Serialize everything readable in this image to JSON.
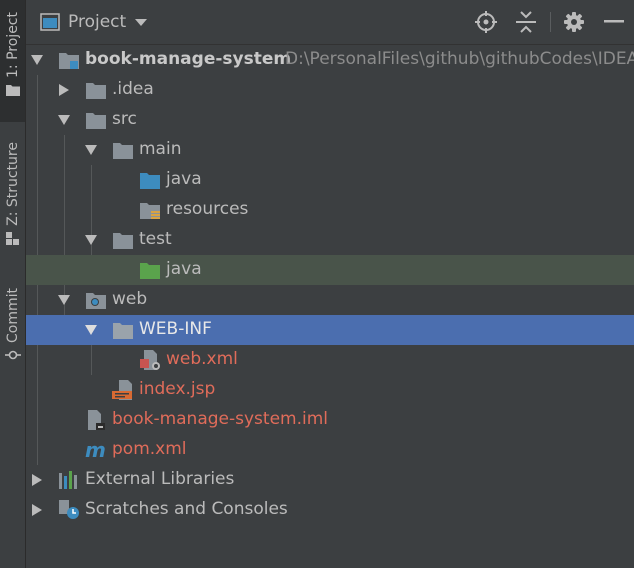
{
  "side_tabs": {
    "project": "1: Project",
    "structure": "Z: Structure",
    "commit": "Commit"
  },
  "header": {
    "title": "Project"
  },
  "tree": {
    "root": {
      "label": "book-manage-system",
      "path": "D:\\PersonalFiles\\github\\githubCodes\\IDEA"
    },
    "idea": ".idea",
    "src": "src",
    "main": "main",
    "main_java": "java",
    "resources": "resources",
    "test": "test",
    "test_java": "java",
    "web": "web",
    "webinf": "WEB-INF",
    "webxml": "web.xml",
    "indexjsp": "index.jsp",
    "iml": "book-manage-system.iml",
    "pom": "pom.xml",
    "ext_libs": "External Libraries",
    "scratches": "Scratches and Consoles"
  },
  "colors": {
    "background": "#3c3f41",
    "selection": "#4b6eaf",
    "highlight": "#49544a",
    "text": "#bbbbbb",
    "modified_red": "#e06c5a",
    "folder_gray": "#8a9299",
    "source_blue": "#3d8cbf",
    "test_green": "#5aa34c"
  }
}
